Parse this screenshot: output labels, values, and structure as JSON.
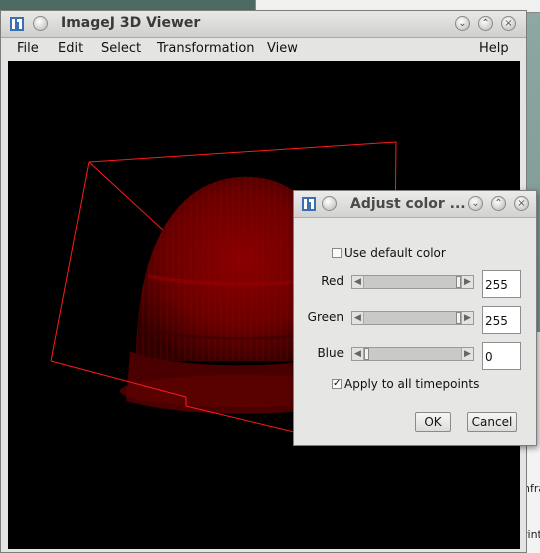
{
  "background": {
    "right_fragments": [
      "nfra",
      "rint"
    ]
  },
  "main_window": {
    "title": "ImageJ 3D Viewer",
    "menu": {
      "file": "File",
      "edit": "Edit",
      "select": "Select",
      "transformation": "Transformation",
      "view": "View",
      "help": "Help"
    }
  },
  "dialog": {
    "title": "Adjust color ...",
    "use_default_color": {
      "label": "Use default color",
      "checked": false
    },
    "sliders": [
      {
        "label": "Red",
        "value": "255",
        "level": 1.0
      },
      {
        "label": "Green",
        "value": "255",
        "level": 1.0
      },
      {
        "label": "Blue",
        "value": "0",
        "level": 0.0
      }
    ],
    "apply_all": {
      "label": "Apply to all timepoints",
      "checked": true
    },
    "ok_label": "OK",
    "cancel_label": "Cancel"
  },
  "colors": {
    "volume": "#8b0000",
    "bounding_box": "#ff1a1a",
    "canvas": "#000000"
  }
}
